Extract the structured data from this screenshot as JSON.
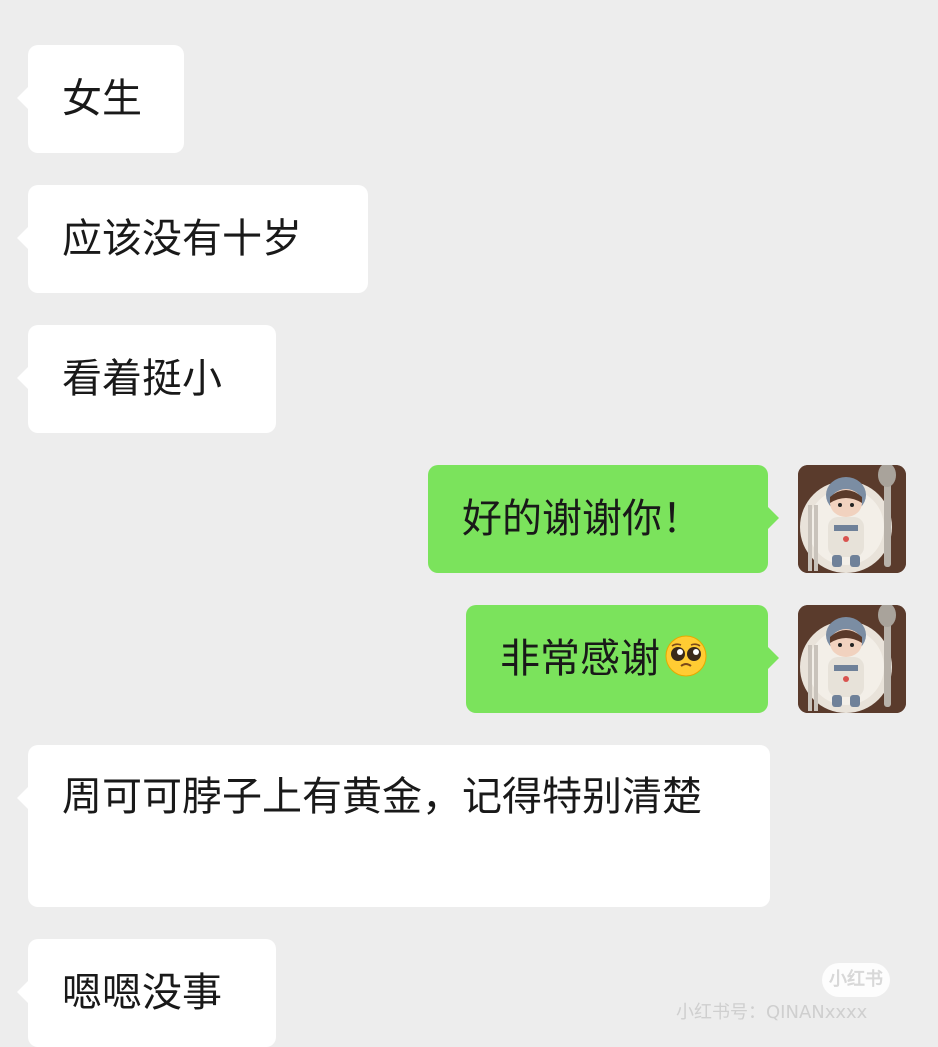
{
  "messages": [
    {
      "side": "in",
      "text": "女生"
    },
    {
      "side": "in",
      "text": "应该没有十岁"
    },
    {
      "side": "in",
      "text": "看着挺小"
    },
    {
      "side": "out",
      "text": "好的谢谢你！"
    },
    {
      "side": "out",
      "text": "非常感谢",
      "emoji": "pleading-face-emoji"
    },
    {
      "side": "in",
      "text": "周可可脖子上有黄金，记得特别清楚"
    },
    {
      "side": "in",
      "text": "嗯嗯没事"
    }
  ],
  "watermark": {
    "logo": "小红书",
    "text": "小红书号：QINANxxxx"
  },
  "colors": {
    "background": "#ededed",
    "incoming_bubble": "#ffffff",
    "outgoing_bubble": "#7be35c"
  },
  "icons": {
    "avatar": "avatar-doll-on-plate-icon",
    "emoji": "pleading-face-emoji"
  }
}
